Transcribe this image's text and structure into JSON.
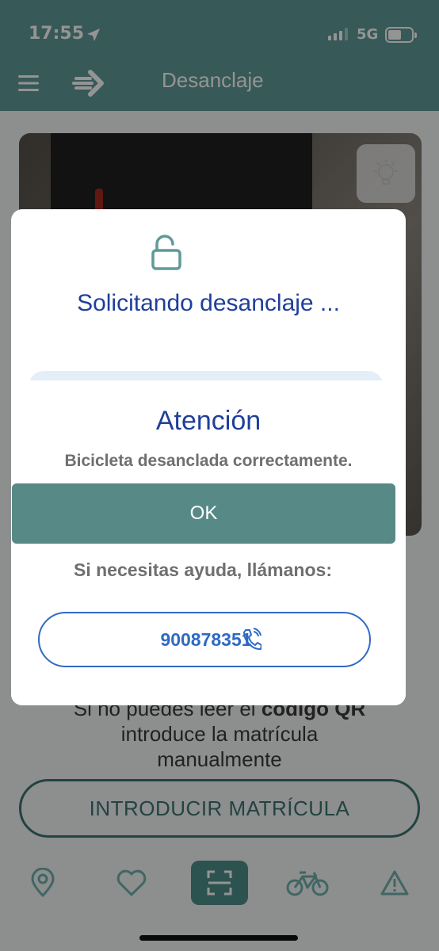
{
  "status_bar": {
    "time": "17:55",
    "network": "5G"
  },
  "header": {
    "title": "Desanclaje"
  },
  "page": {
    "hint_line1_prefix": "Si no puedes leer el",
    "hint_line1_bold": "código QR",
    "hint_line2": "introduce la matrícula",
    "hint_line3": "manualmente",
    "plate_button_label": "INTRODUCIR MATRÍCULA"
  },
  "bottom_nav": {
    "items": [
      {
        "icon": "map-pin-icon"
      },
      {
        "icon": "heart-icon"
      },
      {
        "icon": "qr-scan-icon",
        "active": true
      },
      {
        "icon": "bicycle-icon"
      },
      {
        "icon": "warning-icon"
      }
    ]
  },
  "unlock_dialog": {
    "title": "Solicitando desanclaje ..."
  },
  "alert_dialog": {
    "title": "Atención",
    "message": "Bicicleta desanclada correctamente.",
    "ok_label": "OK",
    "help_text": "Si necesitas ayuda, llámanos:",
    "phone_number": "900878351"
  },
  "colors": {
    "header": "#5f9a97",
    "accent": "#578a86",
    "title_blue": "#1f3f9a",
    "link_blue": "#2f6ac4"
  }
}
